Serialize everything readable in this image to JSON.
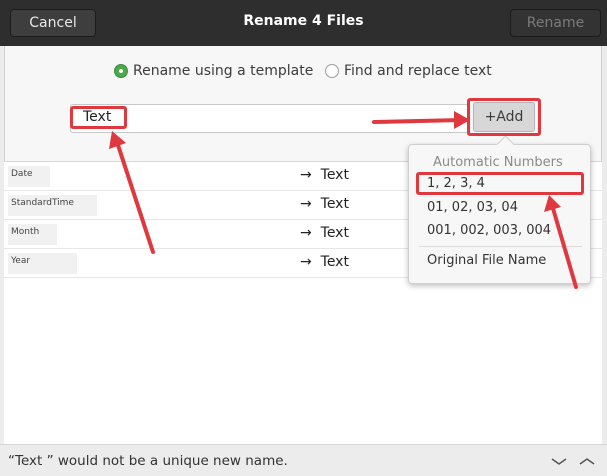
{
  "header": {
    "cancel_label": "Cancel",
    "title": "Rename 4 Files",
    "rename_label": "Rename"
  },
  "mode": {
    "options": [
      {
        "label": "Rename using a template",
        "selected": true
      },
      {
        "label": "Find and replace text",
        "selected": false
      }
    ]
  },
  "template": {
    "value": "Text",
    "add_label": "+Add"
  },
  "files": [
    {
      "original": "Date",
      "arrow": "→",
      "new_name": "Text"
    },
    {
      "original": "StandardTime",
      "arrow": "→",
      "new_name": "Text"
    },
    {
      "original": "Month",
      "arrow": "→",
      "new_name": "Text"
    },
    {
      "original": "Year",
      "arrow": "→",
      "new_name": "Text"
    }
  ],
  "popover": {
    "heading": "Automatic Numbers",
    "items": [
      "1, 2, 3, 4",
      "01, 02, 03, 04",
      "001, 002, 003, 004"
    ],
    "extra_item": "Original File Name"
  },
  "status": {
    "message": "“Text ” would not be a unique new name."
  },
  "colors": {
    "header_bg": "#2e2e2e",
    "accent_green": "#4ba84b",
    "annotation_red": "#e0383f"
  }
}
